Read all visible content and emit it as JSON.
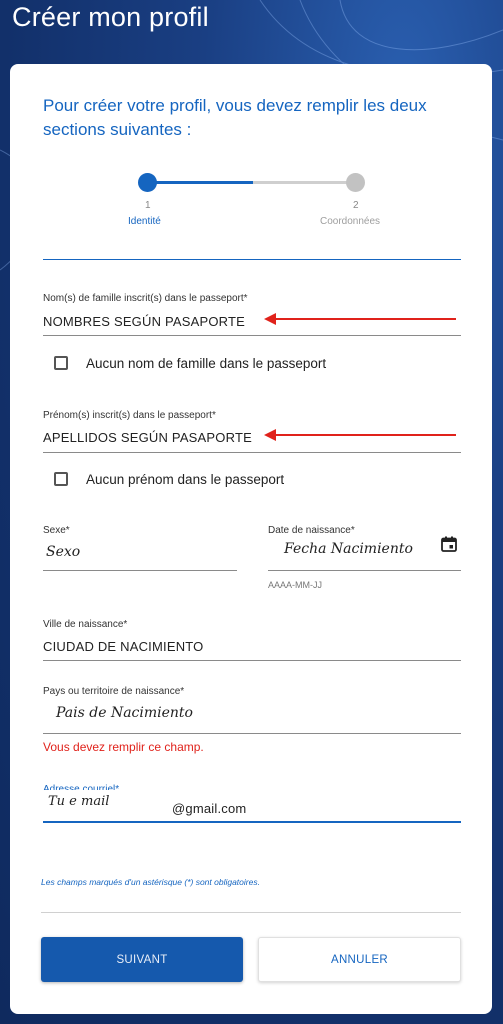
{
  "header": {
    "title": "Créer mon profil"
  },
  "intro": "Pour créer votre profil, vous devez remplir les deux sections suivantes :",
  "stepper": {
    "steps": [
      {
        "number": "1",
        "label": "Identité",
        "state": "active"
      },
      {
        "number": "2",
        "label": "Coordonnées",
        "state": "inactive"
      }
    ]
  },
  "fields": {
    "surname": {
      "label": "Nom(s) de famille inscrit(s) dans le passeport*",
      "value": "NOMBRES SEGÚN PASAPORTE"
    },
    "no_surname": {
      "label": "Aucun nom de famille dans le passeport",
      "checked": false
    },
    "given": {
      "label": "Prénom(s) inscrit(s) dans le passeport*",
      "value": "APELLIDOS SEGÚN PASAPORTE"
    },
    "no_given": {
      "label": "Aucun prénom dans le passeport",
      "checked": false
    },
    "sex": {
      "label": "Sexe*",
      "value": "Sexo"
    },
    "dob": {
      "label": "Date de naissance*",
      "value": "Fecha Nacimiento",
      "hint": "AAAA-MM-JJ",
      "icon": "calendar-icon"
    },
    "city": {
      "label": "Ville de naissance*",
      "value": "CIUDAD DE NACIMIENTO"
    },
    "country": {
      "label": "Pays ou territoire de naissance*",
      "value": "Pais de Nacimiento",
      "error": "Vous devez remplir ce champ."
    },
    "email": {
      "label": "Adresse courriel*",
      "value_handwritten": "Tu e mail",
      "value": "@gmail.com"
    }
  },
  "note": "Les champs marqués d'un astérisque (*) sont obligatoires.",
  "buttons": {
    "next": "SUIVANT",
    "cancel": "ANNULER"
  },
  "colors": {
    "accent": "#1565c0",
    "error": "#e0221b",
    "header_bg": "#1a3f83"
  }
}
